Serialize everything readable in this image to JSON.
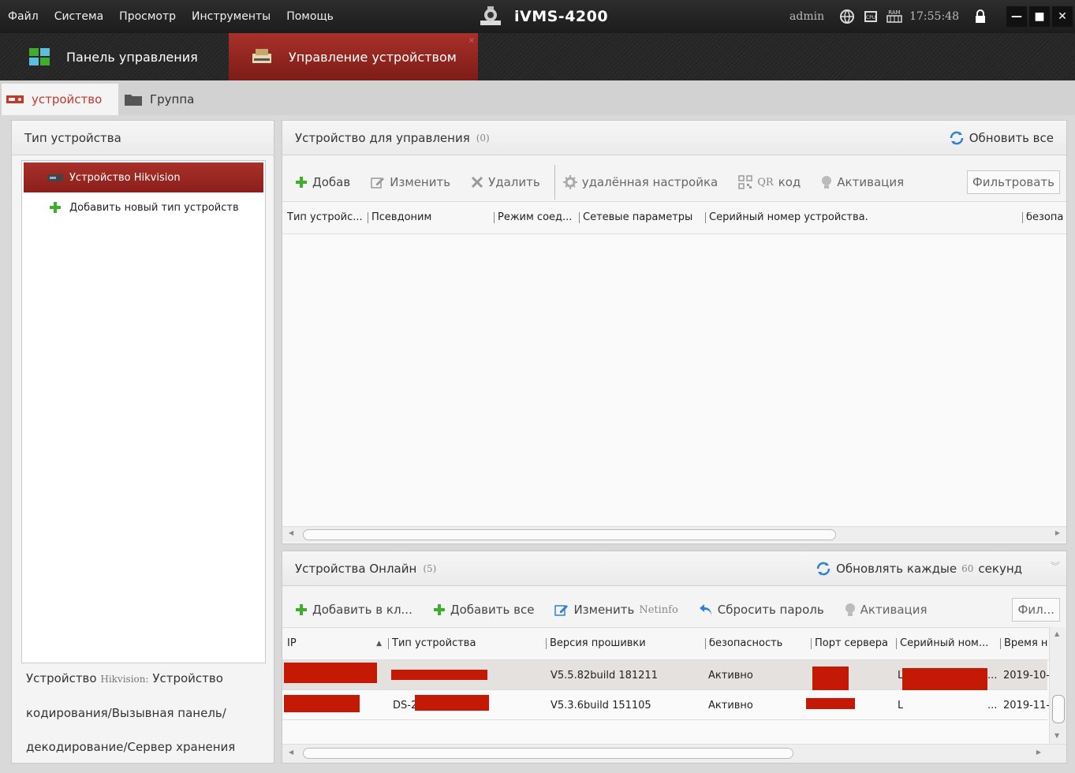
{
  "menu": [
    "Файл",
    "Система",
    "Просмотр",
    "Инструменты",
    "Помощь"
  ],
  "app": {
    "name": "iVMS-4200"
  },
  "status": {
    "user": "admin",
    "time": "17:55:48",
    "cpu": "CPU",
    "ram": "RAM"
  },
  "window": {
    "minimize": "—",
    "maximize": "■",
    "close": "✕"
  },
  "main_tabs": [
    {
      "label": "Панель управления"
    },
    {
      "label": "Управление устройством",
      "close": "×"
    }
  ],
  "sub_tabs": [
    {
      "label": "устройство"
    },
    {
      "label": "Группа"
    }
  ],
  "left_panel": {
    "title": "Тип устройства",
    "items": [
      {
        "label": "Устройство Hikvision"
      },
      {
        "label": "Добавить новый тип устройств"
      }
    ],
    "desc_prefix": "Устройство",
    "desc_brand": "Hikvision:",
    "desc_rest": "Устройство кодирования/Вызывная панель/ декодирование/Сервер хранения"
  },
  "managed": {
    "title": "Устройство для управления",
    "count": "(0)",
    "refresh": "Обновить все",
    "toolbar": {
      "add": "Добав",
      "edit": "Изменить",
      "delete": "Удалить",
      "remote": "удалённая настройка",
      "qr_prefix": "QR",
      "qr_suffix": "код",
      "activate": "Активация",
      "filter": "Фильтровать"
    },
    "columns": [
      "Тип устройс...",
      "Псевдоним",
      "Режим соед...",
      "Сетевые параметры",
      "Серийный номер устройства.",
      "безопа"
    ]
  },
  "online": {
    "title": "Устройства Онлайн",
    "count": "(5)",
    "refresh_prefix": "Обновлять каждые",
    "refresh_num": "60",
    "refresh_suffix": "секунд",
    "toolbar": {
      "add_client": "Добавить в кл...",
      "add_all": "Добавить все",
      "edit_prefix": "Изменить",
      "edit_net": "Netinfo",
      "reset": "Сбросить пароль",
      "activate": "Активация",
      "filter": "Фил..."
    },
    "columns": [
      "IP",
      "Тип устройства",
      "Версия прошивки",
      "безопасность",
      "Порт сервера",
      "Серийный ном...",
      "Время н"
    ],
    "rows": [
      {
        "type": "",
        "firmware": "V5.5.82build 181211",
        "security": "Активно",
        "serial_prefix": "L",
        "serial_suffix": "...",
        "time": "2019-10-"
      },
      {
        "type": "DS-2",
        "firmware": "V5.3.6build 151105",
        "security": "Активно",
        "serial_prefix": "L",
        "serial_suffix": "...",
        "time": "2019-11-"
      }
    ]
  },
  "colors": {
    "accent": "#a8302a",
    "redaction": "#c41a05",
    "green": "#3fae2a",
    "blue": "#2f7fd6"
  }
}
